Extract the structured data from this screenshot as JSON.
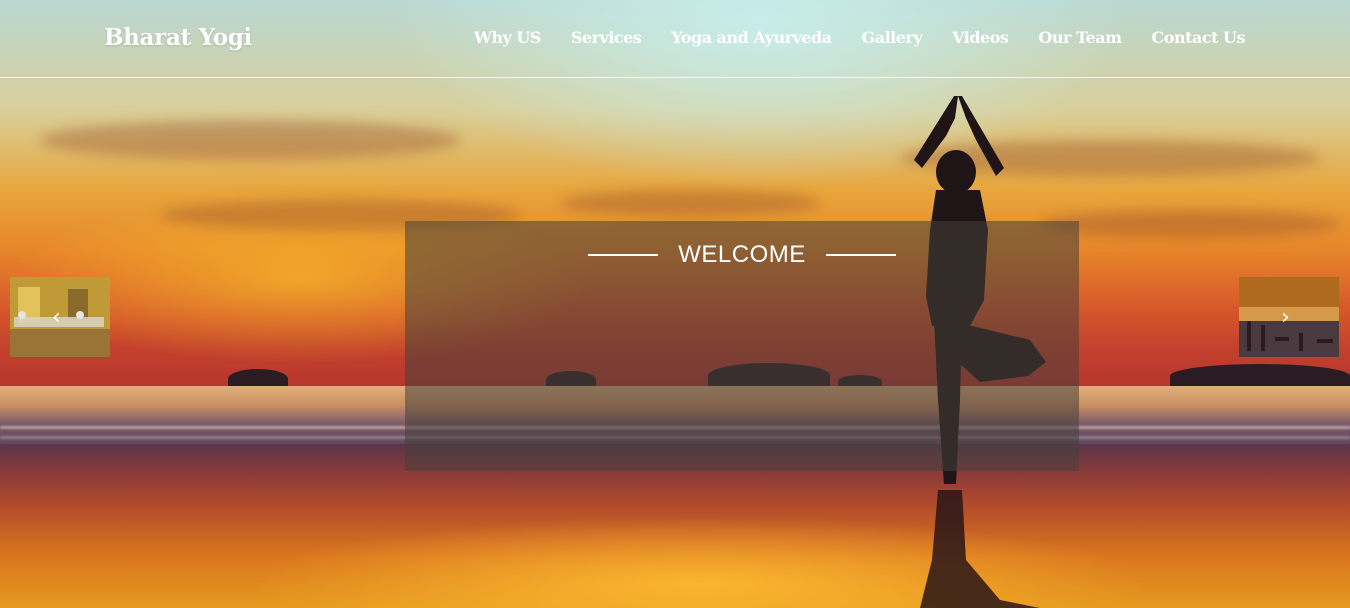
{
  "header": {
    "brand": "Bharat Yogi",
    "nav": [
      {
        "label": "Why US"
      },
      {
        "label": "Services"
      },
      {
        "label": "Yoga and Ayurveda"
      },
      {
        "label": "Gallery"
      },
      {
        "label": "Videos"
      },
      {
        "label": "Our Team"
      },
      {
        "label": "Contact Us"
      }
    ]
  },
  "hero": {
    "welcome": "WELCOME",
    "prev_icon": "chevron-left-icon",
    "next_icon": "chevron-right-icon",
    "prev_arrow": "‹",
    "next_arrow": "›"
  },
  "colors": {
    "text": "#ffffff",
    "panel": "#46403a"
  }
}
